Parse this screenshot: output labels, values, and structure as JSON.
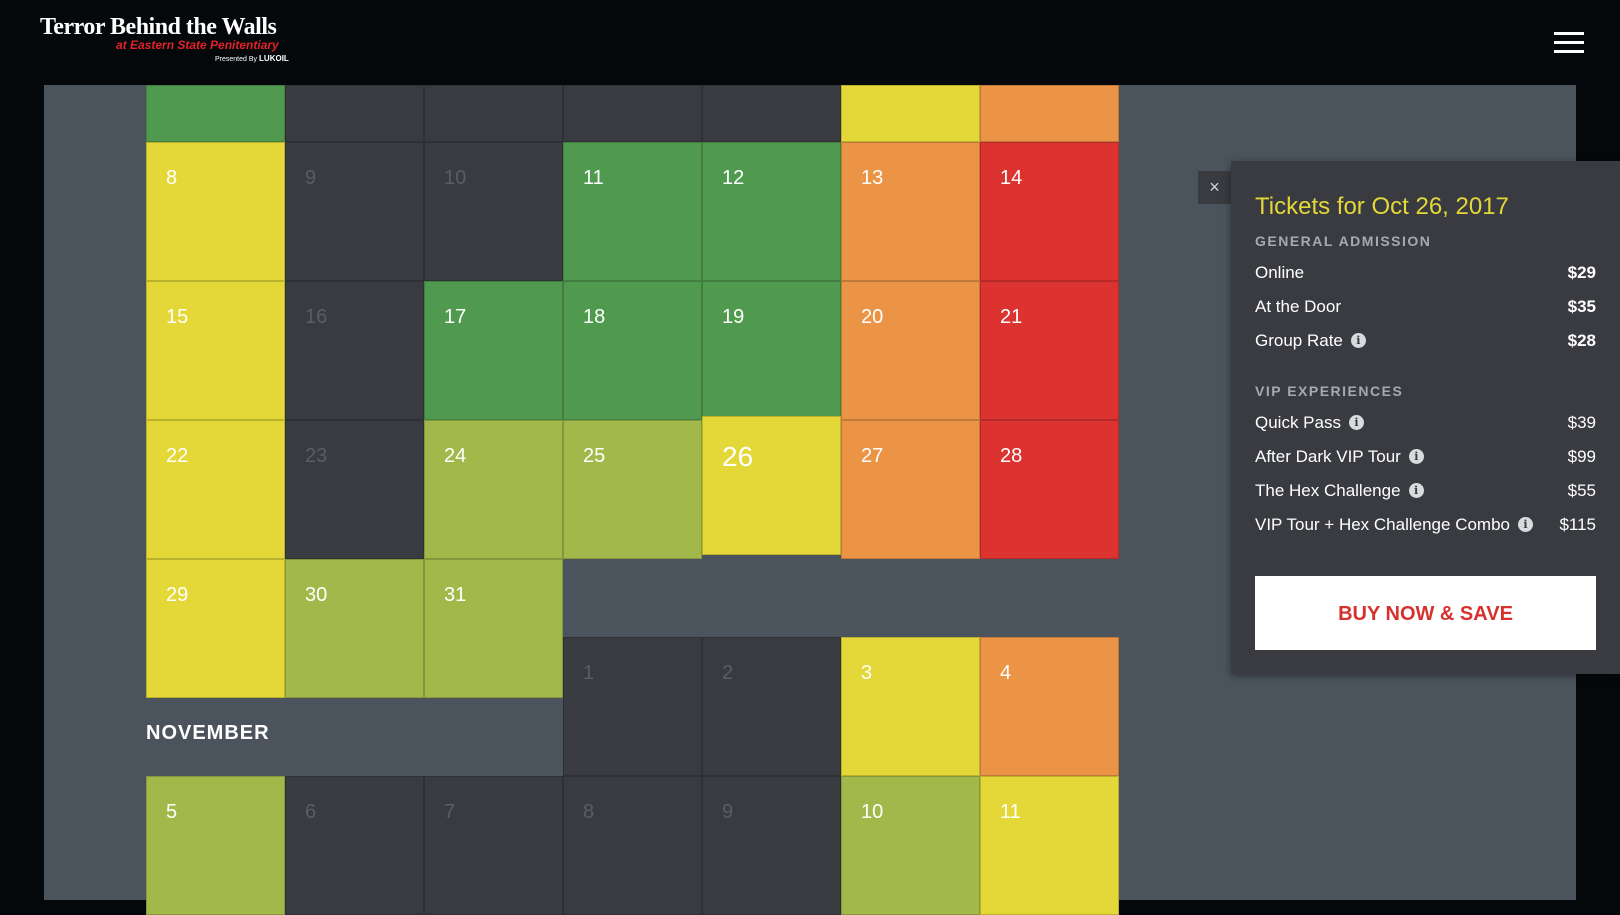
{
  "header": {
    "logo_main": "Terror Behind the Walls",
    "logo_sub": "at Eastern State Penitentiary",
    "logo_presented": "Presented By",
    "logo_sponsor": "LUKOIL"
  },
  "calendar": {
    "days": {
      "oct_8": "8",
      "oct_9": "9",
      "oct_10": "10",
      "oct_11": "11",
      "oct_12": "12",
      "oct_13": "13",
      "oct_14": "14",
      "oct_15": "15",
      "oct_16": "16",
      "oct_17": "17",
      "oct_18": "18",
      "oct_19": "19",
      "oct_20": "20",
      "oct_21": "21",
      "oct_22": "22",
      "oct_23": "23",
      "oct_24": "24",
      "oct_25": "25",
      "oct_26": "26",
      "oct_27": "27",
      "oct_28": "28",
      "oct_29": "29",
      "oct_30": "30",
      "oct_31": "31",
      "nov_1": "1",
      "nov_2": "2",
      "nov_3": "3",
      "nov_4": "4",
      "nov_5": "5",
      "nov_6": "6",
      "nov_7": "7",
      "nov_8": "8",
      "nov_9": "9",
      "nov_10": "10",
      "nov_11": "11"
    },
    "month_label": "NOVEMBER",
    "selected_day": "26",
    "colors": {
      "green": "#509a4f",
      "light_green": "#a3b84a",
      "yellow": "#e3d837",
      "orange": "#ec9446",
      "red": "#dd3330",
      "unavailable": "#393b40"
    }
  },
  "popup": {
    "close_label": "×",
    "title": "Tickets for Oct 26, 2017",
    "general_heading": "GENERAL ADMISSION",
    "general": [
      {
        "label": "Online",
        "price": "$29"
      },
      {
        "label": "At the Door",
        "price": "$35"
      },
      {
        "label": "Group Rate",
        "price": "$28"
      }
    ],
    "vip_heading": "VIP EXPERIENCES",
    "vip": [
      {
        "label": "Quick Pass",
        "price": "$39"
      },
      {
        "label": "After Dark VIP Tour",
        "price": "$99"
      },
      {
        "label": "The Hex Challenge",
        "price": "$55"
      },
      {
        "label": "VIP Tour + Hex Challenge Combo",
        "price": "$115"
      }
    ],
    "info_glyph": "i",
    "buy_label": "BUY NOW & SAVE"
  }
}
